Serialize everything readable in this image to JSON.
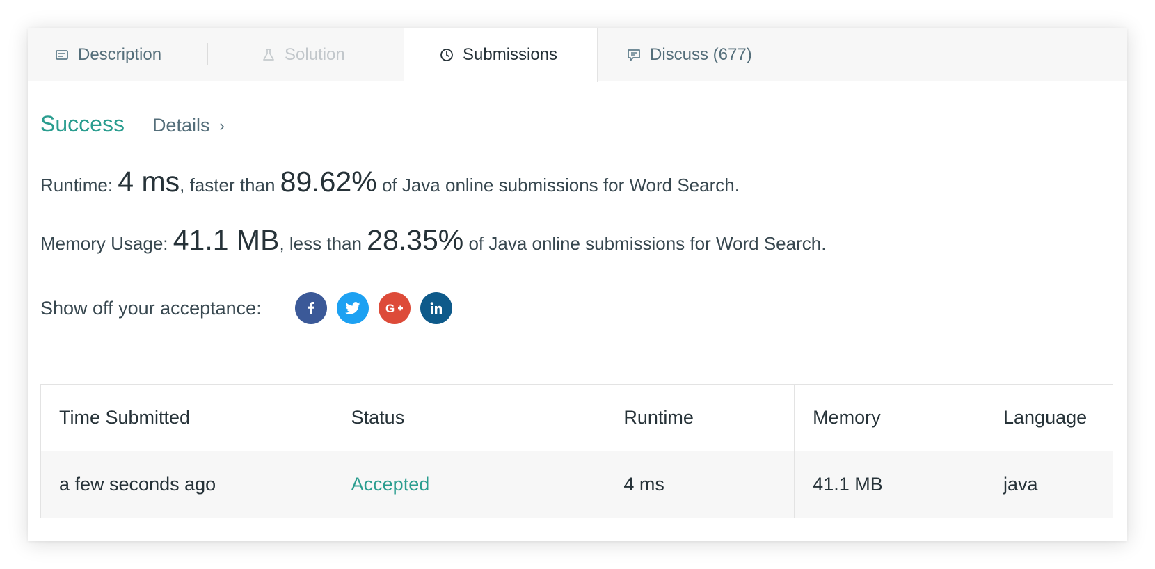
{
  "tabs": {
    "description": "Description",
    "solution": "Solution",
    "submissions": "Submissions",
    "discuss": "Discuss (677)"
  },
  "result": {
    "status": "Success",
    "details": "Details",
    "details_chevron": "›"
  },
  "runtime": {
    "label": "Runtime: ",
    "value": "4 ms",
    "comparison": ", faster than ",
    "percent": "89.62%",
    "suffix": " of Java online submissions for Word Search."
  },
  "memory": {
    "label": "Memory Usage: ",
    "value": "41.1 MB",
    "comparison": ", less than ",
    "percent": "28.35%",
    "suffix": " of Java online submissions for Word Search."
  },
  "share": {
    "label": "Show off your acceptance:",
    "icons": {
      "facebook": "facebook-icon",
      "twitter": "twitter-icon",
      "google_plus": "google-plus-icon",
      "linkedin": "linkedin-icon"
    }
  },
  "table": {
    "headers": [
      "Time Submitted",
      "Status",
      "Runtime",
      "Memory",
      "Language"
    ],
    "rows": [
      [
        "a few seconds ago",
        "Accepted",
        "4 ms",
        "41.1 MB",
        "java"
      ]
    ]
  },
  "colors": {
    "success": "#2a9d8f",
    "facebook": "#3b5998",
    "twitter": "#1da1f2",
    "google_plus": "#dd4b39",
    "linkedin": "#0e5a8a"
  }
}
